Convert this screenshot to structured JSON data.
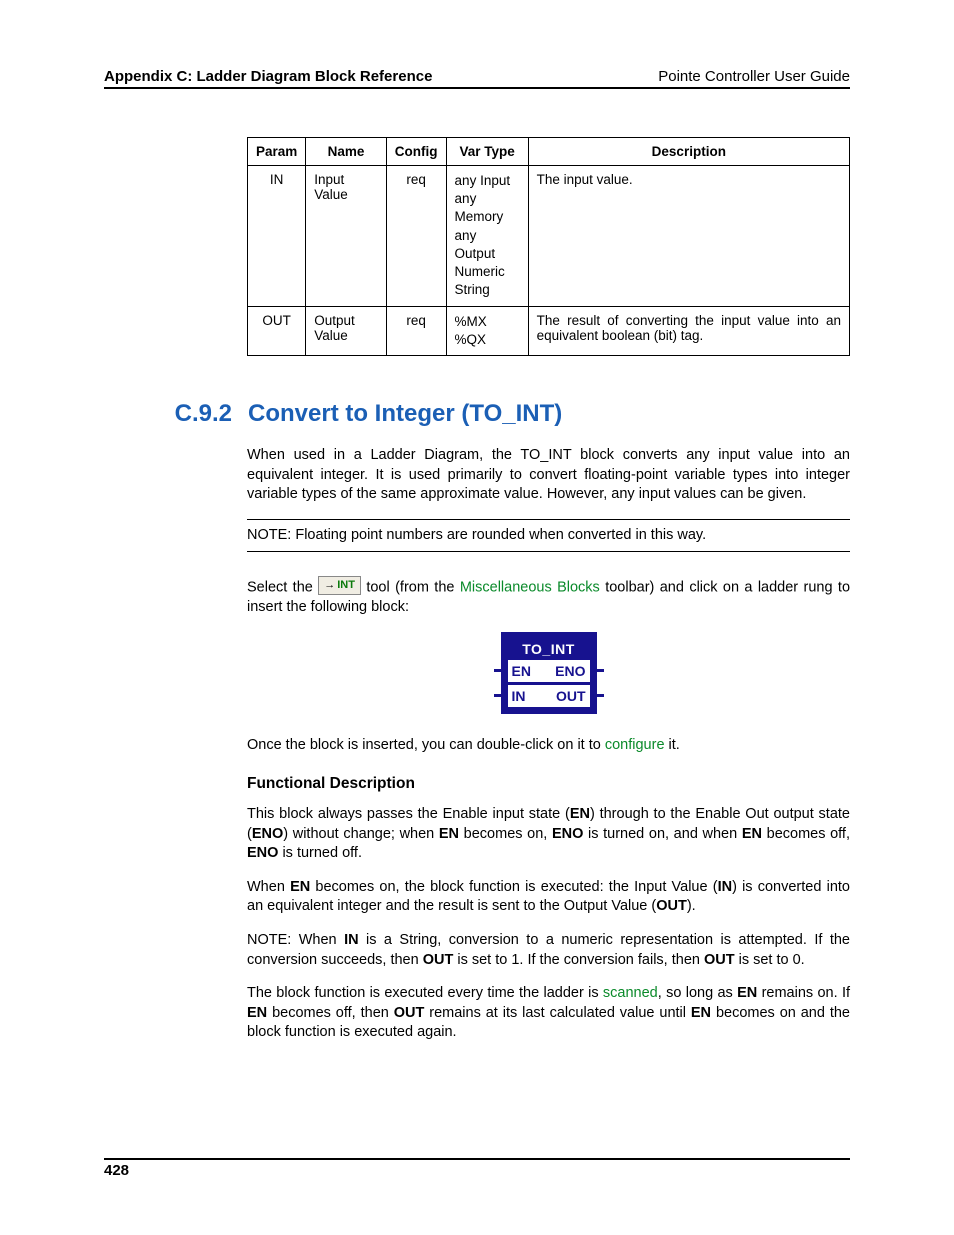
{
  "header": {
    "left": "Appendix C: Ladder Diagram Block Reference",
    "right": "Pointe Controller User Guide"
  },
  "table": {
    "headers": [
      "Param",
      "Name",
      "Config",
      "Var Type",
      "Description"
    ],
    "rows": [
      {
        "param": "IN",
        "name": "Input Value",
        "config": "req",
        "vartype": "any Input\nany Memory\nany Output\nNumeric\nString",
        "desc": "The input value."
      },
      {
        "param": "OUT",
        "name": "Output Value",
        "config": "req",
        "vartype": "%MX\n%QX",
        "desc": "The result of converting the input value into an equivalent boolean (bit) tag."
      }
    ]
  },
  "section": {
    "num": "C.9.2",
    "title": "Convert to Integer (TO_INT)"
  },
  "p_intro": "When used in a Ladder Diagram, the TO_INT block converts any input value into an equivalent integer. It is used primarily to convert floating-point variable types into integer variable types of the same approximate value. However, any input values can be given.",
  "note1": "NOTE: Floating point numbers are rounded when converted in this way.",
  "select_1": "Select the ",
  "tool_arrow": "→",
  "tool_int": "INT",
  "select_2": " tool (from the ",
  "link_misc": "Miscellaneous Blocks",
  "select_3": " toolbar) and click on a ladder rung to insert the following block:",
  "block": {
    "title": "TO_INT",
    "en": "EN",
    "eno": "ENO",
    "in": "IN",
    "out": "OUT"
  },
  "p_once_1": "Once the block is inserted, you can double-click on it to ",
  "link_configure": "configure",
  "p_once_2": " it.",
  "subhead_fd": "Functional Description",
  "fd_p1_a": "This block always passes the Enable input state (",
  "fd_p1_b": ") through to the Enable Out output state (",
  "fd_p1_c": ") without change; when ",
  "fd_p1_d": " becomes on, ",
  "fd_p1_e": " is turned on, and when ",
  "fd_p1_f": " becomes off, ",
  "fd_p1_g": " is turned off.",
  "fd_p2_a": "When ",
  "fd_p2_b": " becomes on, the block function is executed: the Input Value (",
  "fd_p2_c": ") is converted into an equivalent integer and the result is sent to the Output Value (",
  "fd_p2_d": ").",
  "fd_p3_a": "NOTE: When ",
  "fd_p3_b": " is a String, conversion to a numeric representation is attempted. If the conversion succeeds, then ",
  "fd_p3_c": " is set to 1. If the conversion fails, then ",
  "fd_p3_d": " is set to 0.",
  "fd_p4_a": "The block function is executed every time the ladder is ",
  "link_scanned": "scanned",
  "fd_p4_b": ", so long as ",
  "fd_p4_c": " remains on. If ",
  "fd_p4_d": " becomes off, then ",
  "fd_p4_e": " remains at its last calculated value until ",
  "fd_p4_f": " becomes on and the block function is executed again.",
  "bold": {
    "EN": "EN",
    "ENO": "ENO",
    "IN": "IN",
    "OUT": "OUT"
  },
  "footer": "428"
}
